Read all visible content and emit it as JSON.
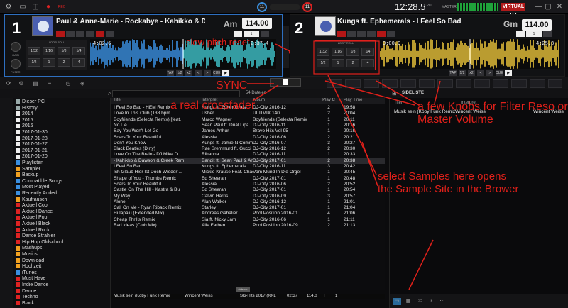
{
  "topbar": {
    "clock": "12:28.5",
    "cpu": "CPU",
    "master": "MASTER",
    "logo": "VIRTUAL DJ",
    "rec": "REC",
    "knob_a": "11",
    "knob_b": "11"
  },
  "deck_left": {
    "number": "1",
    "title": "Paul & Anne-Marie - Rockabye - Kahikko & Daws",
    "key": "Am",
    "bpm": "114.00",
    "position": "4:02.6",
    "remaining": "2:37.4",
    "loop_roll": "LOOP ROLL",
    "gain": "GAIN",
    "filter": "FILTER",
    "pads": [
      "1/32",
      "1/16",
      "1/8",
      "1/4",
      "1/2",
      "1",
      "2",
      "4"
    ],
    "pad_hdr": "SAMPLER",
    "transport": [
      "CUE",
      "▶",
      "TAP",
      "1/2",
      "x2",
      "<",
      ">"
    ],
    "sync_num": "1"
  },
  "deck_right": {
    "number": "2",
    "title": "Kungs ft. Ephemerals - I Feel So Bad",
    "key": "Gm",
    "bpm": "114.00",
    "position": "0:00.0",
    "remaining": "4:25.3",
    "loop_roll": "LOOP ROLL",
    "pads": [
      "1/32",
      "1/16",
      "1/8",
      "1/4",
      "1/2",
      "1",
      "2",
      "4"
    ],
    "transport": [
      "CUE",
      "▶",
      "TAP",
      "1/2",
      "x2",
      "<",
      ">"
    ],
    "sync_num": "1"
  },
  "browser": {
    "search_placeholder": "",
    "file_count": "54 Dateien",
    "sideliste_label": "SIDELISTE",
    "sidebar_tab": "sidebar",
    "columns": [
      "Titel",
      "Interpret",
      "Album",
      "Play C",
      "Play Time"
    ]
  },
  "folders": [
    {
      "name": "Dieser PC",
      "color": "#9aa"
    },
    {
      "name": "History",
      "color": "#9aa"
    },
    {
      "name": "2014",
      "color": "#eee"
    },
    {
      "name": "2015",
      "color": "#eee"
    },
    {
      "name": "2016",
      "color": "#eee"
    },
    {
      "name": "2017-01-30",
      "color": "#eee"
    },
    {
      "name": "2017-01-28",
      "color": "#eee"
    },
    {
      "name": "2017-01-27",
      "color": "#eee"
    },
    {
      "name": "2017-01-21",
      "color": "#eee"
    },
    {
      "name": "2017-01-20",
      "color": "#eee"
    },
    {
      "name": "Playlisten",
      "color": "#3a8fe0"
    },
    {
      "name": "Sampler",
      "color": "#f0a020"
    },
    {
      "name": "Backup",
      "color": "#f0a020"
    },
    {
      "name": "Compatible Songs",
      "color": "#3a8fe0"
    },
    {
      "name": "Most Played",
      "color": "#3a8fe0"
    },
    {
      "name": "Recently Added",
      "color": "#3a8fe0"
    },
    {
      "name": "Kaufrausch",
      "color": "#f0a020"
    },
    {
      "name": "Aktuell Cool",
      "color": "#d22"
    },
    {
      "name": "Aktuell Dance",
      "color": "#d22"
    },
    {
      "name": "Aktuell Pop",
      "color": "#d22"
    },
    {
      "name": "Aktuell Black",
      "color": "#d22"
    },
    {
      "name": "Aktuell Rock",
      "color": "#d22"
    },
    {
      "name": "Dance Strahler",
      "color": "#d22"
    },
    {
      "name": "Hip Hop Oldschool",
      "color": "#d22"
    },
    {
      "name": "Mashups",
      "color": "#f0a020"
    },
    {
      "name": "Musics",
      "color": "#f0a020"
    },
    {
      "name": "Download",
      "color": "#f0a020"
    },
    {
      "name": "Hochzeit",
      "color": "#f0a020"
    },
    {
      "name": "iTunes",
      "color": "#3a8fe0"
    },
    {
      "name": "Must Have",
      "color": "#d22"
    },
    {
      "name": "Indie Dance",
      "color": "#d22"
    },
    {
      "name": "Dance",
      "color": "#d22"
    },
    {
      "name": "Techno",
      "color": "#d22"
    },
    {
      "name": "Black",
      "color": "#d22"
    }
  ],
  "tracks": [
    {
      "title": "I Feel So Bad - HEM Remix",
      "artist": "Kungs ft. Ephemerals",
      "album": "DJ-City 2016-12",
      "plays": "2",
      "time": "19:58"
    },
    {
      "title": "Love In This Club (138 bpm",
      "artist": "Usher",
      "album": "ULTIMIX 140",
      "plays": "2",
      "time": "20:04"
    },
    {
      "title": "Boyfriends (Selecta Remix) [feat.",
      "artist": "Marco Wagner",
      "album": "Boyfriends (Selecta Remix",
      "plays": "1",
      "time": "20:11"
    },
    {
      "title": "No Lie",
      "artist": "Sean Paul ft. Dual Lipa",
      "album": "DJ-City 2016-11",
      "plays": "1",
      "time": "20:16"
    },
    {
      "title": "Say You Won't Let Go",
      "artist": "James Arthur",
      "album": "Bravo Hits Vol 95",
      "plays": "1",
      "time": "20:19"
    },
    {
      "title": "Scars To Your Beautiful",
      "artist": "Alessia",
      "album": "DJ-City 2016-06",
      "plays": "2",
      "time": "20:21"
    },
    {
      "title": "Don't You Know",
      "artist": "Kungs ft. Jamie N Commons",
      "album": "DJ-City 2016-07",
      "plays": "3",
      "time": "20:27"
    },
    {
      "title": "Black Beatles (Dirty)",
      "artist": "Rae Sremmurd ft. Gucci Mane",
      "album": "DJ-City 2016-12",
      "plays": "2",
      "time": "20:30"
    },
    {
      "title": "Love On The Brain - DJ Mike D",
      "artist": "Rihanna",
      "album": "DJ-City 2016-11",
      "plays": "1",
      "time": "20:33"
    },
    {
      "title": "- Kahikko & Dawson & Creek Rem",
      "artist": "Bandit ft. Sean Paul & Anne-M",
      "album": "DJ-City 2017-01",
      "plays": "2",
      "time": "20:38"
    },
    {
      "title": "I Feel So Bad",
      "artist": "Kungs ft. Ephemerals",
      "album": "DJ-City 2016-11",
      "plays": "3",
      "time": "20:42"
    },
    {
      "title": "Ich Glaub Hier Ist Doch Wieder ...",
      "artist": "Mickie Krause Feat. Chaos ...",
      "album": "Vom Mund In Die Orgel",
      "plays": "1",
      "time": "20:45"
    },
    {
      "title": "Shape of You - Thombs Remix",
      "artist": "Ed Sheeran",
      "album": "DJ-City 2017-01",
      "plays": "1",
      "time": "20:48"
    },
    {
      "title": "Scars To Your Beautiful",
      "artist": "Alessia",
      "album": "DJ-City 2016-06",
      "plays": "2",
      "time": "20:52"
    },
    {
      "title": "Castle On The Hill - Kastra & Bu",
      "artist": "Ed Sheeran",
      "album": "DJ-City 2017-01",
      "plays": "1",
      "time": "20:54"
    },
    {
      "title": "My Way",
      "artist": "Calvin Harris",
      "album": "DJ-City 2016-09",
      "plays": "3",
      "time": "20:57"
    },
    {
      "title": "Alone",
      "artist": "Alan Walker",
      "album": "DJ-City 2016-12",
      "plays": "1",
      "time": "21:01"
    },
    {
      "title": "Call On Me - Ryan Riback Remix",
      "artist": "Starley",
      "album": "DJ-City 2017-01",
      "plays": "1",
      "time": "21:04"
    },
    {
      "title": "Hulapalu (Extended Mix)",
      "artist": "Andreas Gabalier",
      "album": "Pool Position 2016-01",
      "plays": "4",
      "time": "21:06"
    },
    {
      "title": "Cheap Thrills Remix",
      "artist": "Sia ft. Nicky Jam",
      "album": "DJ-City 2016-06",
      "plays": "1",
      "time": "21:11"
    },
    {
      "title": "Bad Ideas (Club Mix)",
      "artist": "Alle Farben",
      "album": "Pool Position 2016-09",
      "plays": "2",
      "time": "21:13"
    }
  ],
  "nowplaying": {
    "title": "Musik sein (Koby Funk Remix",
    "artist": "Wincent Weiss",
    "album": "Ski-Hits 2017 (XXL",
    "time": "02:37",
    "bpm": "114.0",
    "key": "F",
    "plays": "1"
  },
  "sideliste": {
    "columns": [
      "Titel",
      "Interpret"
    ],
    "row_title": "Musik sein (Koby Funk Remix",
    "row_artist": "Wincent Weiss",
    "row_artist2": "Wincent Weiss"
  },
  "annotations": {
    "slow_pitch": "slow pitch reset",
    "sync": "SYNC",
    "crossfader": "a real crossfader",
    "knobs": "a few Knobs for Filter Reso or",
    "master_volume": "Master Volume",
    "samples_1": "select Samples here opens",
    "samples_2": "the Sample Site in the Brower"
  },
  "colors": {
    "accent_blue": "#2e6fc0",
    "accent_red": "#d22020",
    "annotation": "#e0201a",
    "wave_left": "#3ec1c9",
    "wave_right": "#e6c13a"
  }
}
